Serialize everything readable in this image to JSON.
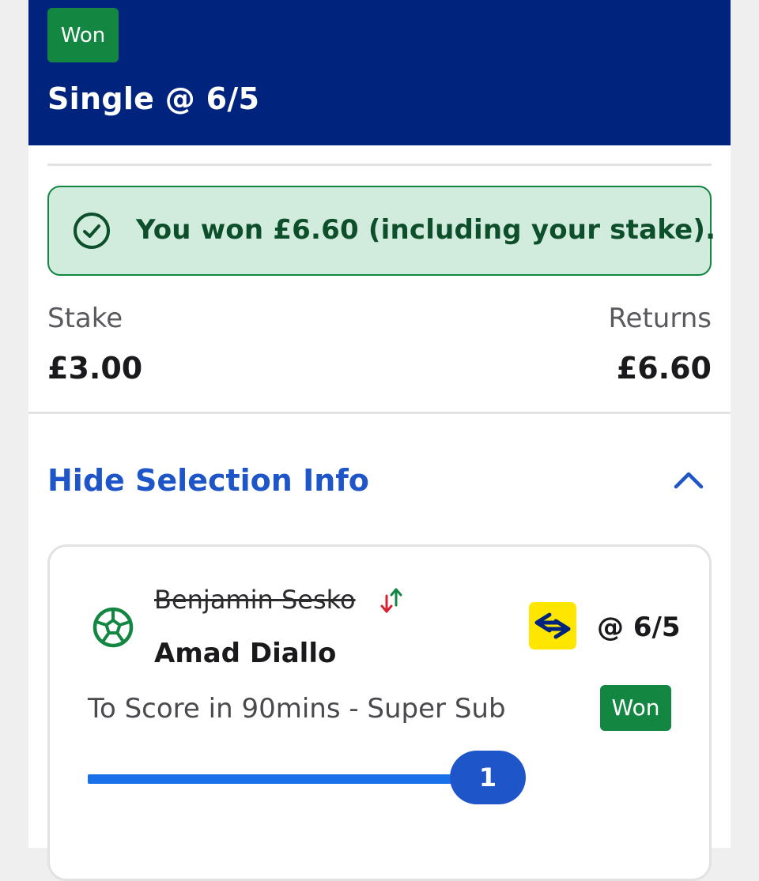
{
  "header": {
    "status_badge": "Won",
    "bet_title": "Single @ 6/5"
  },
  "result_banner": {
    "message": "You won £6.60 (including your stake).",
    "icon": "check-circle-icon"
  },
  "summary": {
    "stake_label": "Stake",
    "stake_value": "£3.00",
    "returns_label": "Returns",
    "returns_value": "£6.60"
  },
  "selection_toggle": {
    "label": "Hide Selection Info",
    "icon": "chevron-up-icon"
  },
  "selection": {
    "sport_icon": "football-icon",
    "original_player": "Benjamin Sesko",
    "substitution_icon": "swap-arrows-icon",
    "player": "Amad Diallo",
    "super_sub_icon": "super-sub-icon",
    "price": "@ 6/5",
    "market": "To Score in 90mins - Super Sub",
    "status_badge": "Won",
    "progress": {
      "count": "1",
      "fraction": 1.0
    }
  },
  "colors": {
    "header_bg": "#00247d",
    "won_green": "#138741",
    "banner_bg": "#d1ebdd",
    "link_blue": "#1e55c8",
    "progress_blue": "#1871e8",
    "super_sub_yellow": "#ffe600"
  }
}
